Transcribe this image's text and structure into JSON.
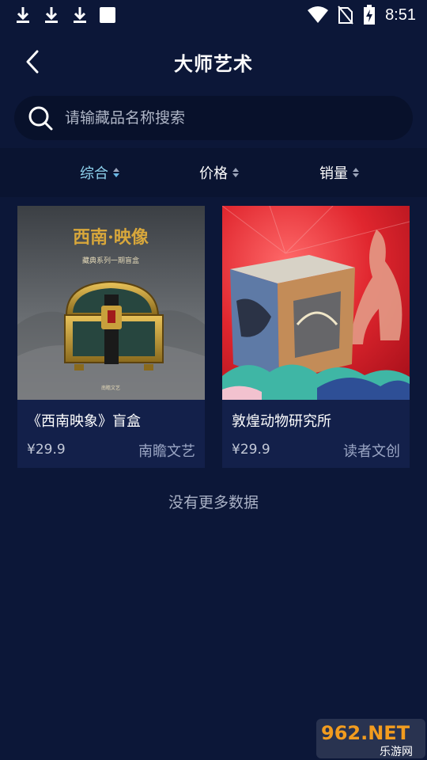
{
  "status_bar": {
    "time": "8:51",
    "icons": [
      "download-icon",
      "download-icon",
      "download-icon",
      "square-icon",
      "wifi-icon",
      "no-sim-icon",
      "battery-charging-icon"
    ]
  },
  "header": {
    "title": "大师艺术",
    "back_icon": "chevron-left-icon"
  },
  "search": {
    "placeholder": "请输藏品名称搜索",
    "icon": "search-icon"
  },
  "filters": [
    {
      "label": "综合",
      "active": true
    },
    {
      "label": "价格",
      "active": false
    },
    {
      "label": "销量",
      "active": false
    }
  ],
  "products": [
    {
      "title": "《西南映象》盲盒",
      "price": "¥29.9",
      "brand": "南瞻文艺",
      "image_text": "西南·映像",
      "image_subtext": "藏典系列一期盲盒",
      "image_footer": "南瞻文艺"
    },
    {
      "title": "敦煌动物研究所",
      "price": "¥29.9",
      "brand": "读者文创"
    }
  ],
  "footer_text": "没有更多数据",
  "watermark": {
    "text": "962.NET",
    "subtext": "乐游网"
  },
  "colors": {
    "background": "#0c1738",
    "card": "#13204a",
    "active_filter": "#8fd3ee",
    "search_bg": "#08112b"
  }
}
